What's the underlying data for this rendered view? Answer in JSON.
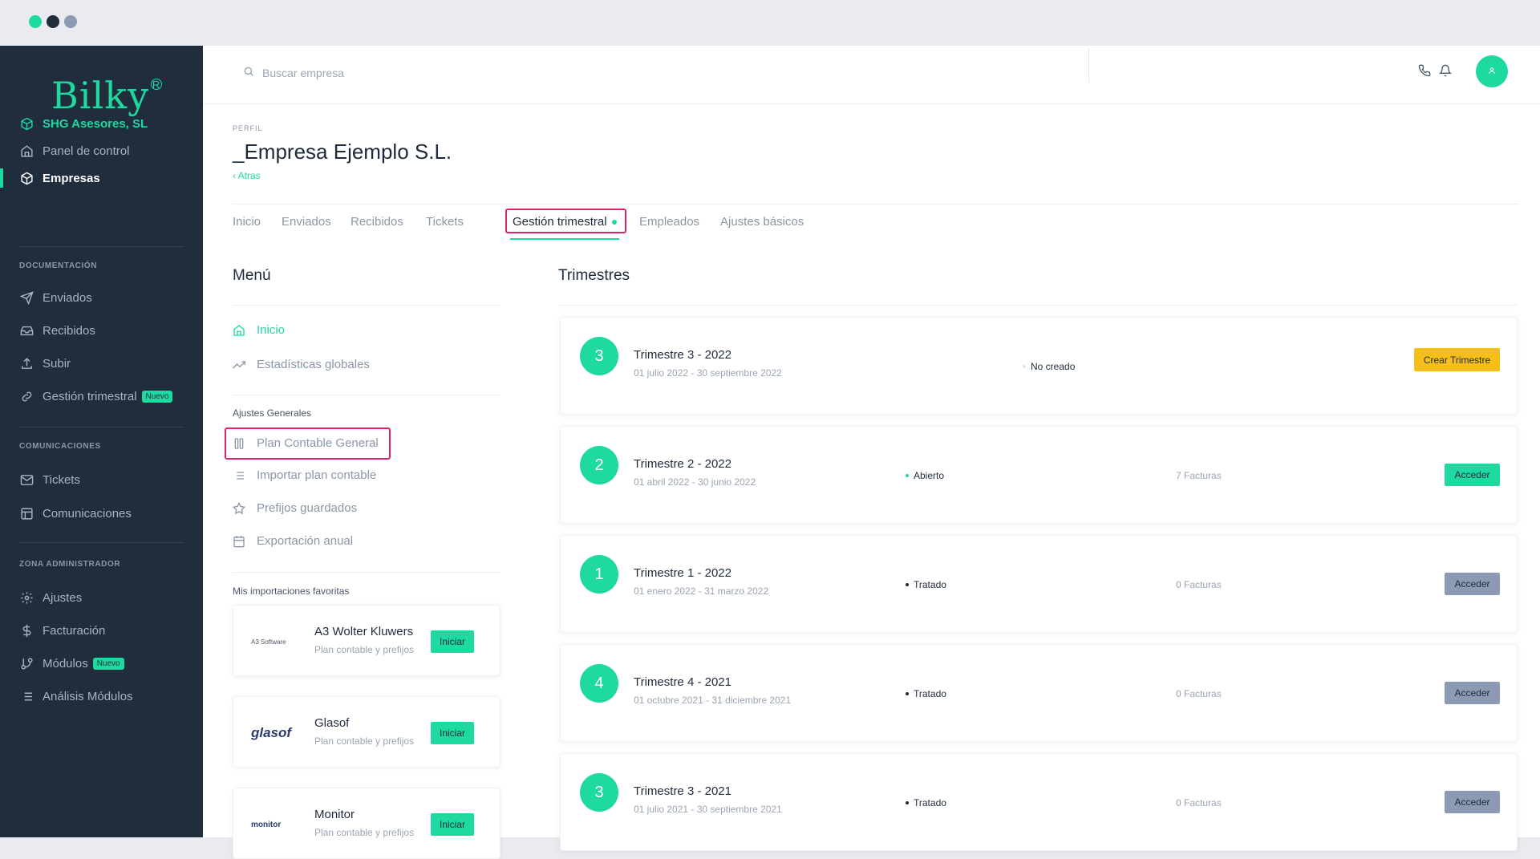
{
  "window": {
    "dots": [
      "#1ed9a0",
      "#1f2d3d",
      "#8c9ab4"
    ]
  },
  "colors": {
    "accent": "#1ed9a0",
    "sidebar_bg": "#1f2d3d",
    "highlight": "#e0245e",
    "btn_yellow": "#f5be19",
    "btn_gray": "#8c9ab4"
  },
  "sidebar": {
    "logo": "Bilky",
    "logo_mark": "R",
    "company": "SHG Asesores, SL",
    "items_top": [
      {
        "label": "Panel de control",
        "icon": "home-icon"
      },
      {
        "label": "Empresas",
        "icon": "cube-icon"
      }
    ],
    "section_docs": "DOCUMENTACIÓN",
    "items_docs": [
      {
        "label": "Enviados",
        "icon": "send-icon"
      },
      {
        "label": "Recibidos",
        "icon": "inbox-icon"
      },
      {
        "label": "Subir",
        "icon": "upload-icon"
      },
      {
        "label": "Gestión trimestral",
        "icon": "link-icon",
        "badge": "Nuevo"
      }
    ],
    "section_com": "COMUNICACIONES",
    "items_com": [
      {
        "label": "Tickets",
        "icon": "mail-icon"
      },
      {
        "label": "Comunicaciones",
        "icon": "layout-icon"
      }
    ],
    "section_admin": "ZONA ADMINISTRADOR",
    "items_admin": [
      {
        "label": "Ajustes",
        "icon": "gear-icon"
      },
      {
        "label": "Facturación",
        "icon": "dollar-icon"
      },
      {
        "label": "Módulos",
        "icon": "git-icon",
        "badge": "Nuevo"
      },
      {
        "label": "Análisis Módulos",
        "icon": "list-icon"
      }
    ]
  },
  "topbar": {
    "search_placeholder": "Buscar empresa"
  },
  "header": {
    "section_label": "PERFIL",
    "title": "_Empresa Ejemplo S.L.",
    "back": "Atras"
  },
  "tabs": [
    "Inicio",
    "Enviados",
    "Recibidos",
    "Tickets",
    "Gestión trimestral",
    "Empleados",
    "Ajustes básicos"
  ],
  "menu": {
    "title": "Menú",
    "items": [
      {
        "label": "Inicio",
        "icon": "home-icon"
      },
      {
        "label": "Estadísticas globales",
        "icon": "trending-up-icon"
      }
    ],
    "section_ajustes": "Ajustes Generales",
    "ajustes_items": [
      {
        "label": "Plan Contable General",
        "icon": "columns-icon"
      },
      {
        "label": "Importar plan contable",
        "icon": "list-icon"
      },
      {
        "label": "Prefijos guardados",
        "icon": "star-icon"
      },
      {
        "label": "Exportación anual",
        "icon": "calendar-icon"
      }
    ],
    "section_fav": "Mis importaciones favoritas",
    "favorites": [
      {
        "name": "A3 Wolter Kluwers",
        "sub": "Plan contable y prefijos",
        "button": "Iniciar",
        "logo_text": "A3 Software"
      },
      {
        "name": "Glasof",
        "sub": "Plan contable y prefijos",
        "button": "Iniciar",
        "logo_text": "glasof"
      },
      {
        "name": "Monitor",
        "sub": "Plan contable y prefijos",
        "button": "Iniciar",
        "logo_text": "monitor"
      }
    ]
  },
  "trimestres": {
    "title": "Trimestres",
    "items": [
      {
        "num": "3",
        "title": "Trimestre 3 - 2022",
        "dates": "01 julio 2022 - 30 septiembre 2022",
        "status": "No creado",
        "count": "",
        "button": "Crear Trimestre",
        "btn_style": "yellow"
      },
      {
        "num": "2",
        "title": "Trimestre 2 - 2022",
        "dates": "01 abril 2022 - 30 junio 2022",
        "status": "Abierto",
        "count": "7 Facturas",
        "button": "Acceder",
        "btn_style": "green"
      },
      {
        "num": "1",
        "title": "Trimestre 1 - 2022",
        "dates": "01 enero 2022 - 31 marzo 2022",
        "status": "Tratado",
        "count": "0 Facturas",
        "button": "Acceder",
        "btn_style": "gray"
      },
      {
        "num": "4",
        "title": "Trimestre 4 - 2021",
        "dates": "01 octubre 2021 - 31 diciembre 2021",
        "status": "Tratado",
        "count": "0 Facturas",
        "button": "Acceder",
        "btn_style": "gray"
      },
      {
        "num": "3",
        "title": "Trimestre 3 - 2021",
        "dates": "01 julio 2021 - 30 septiembre 2021",
        "status": "Tratado",
        "count": "0 Facturas",
        "button": "Acceder",
        "btn_style": "gray"
      }
    ]
  }
}
